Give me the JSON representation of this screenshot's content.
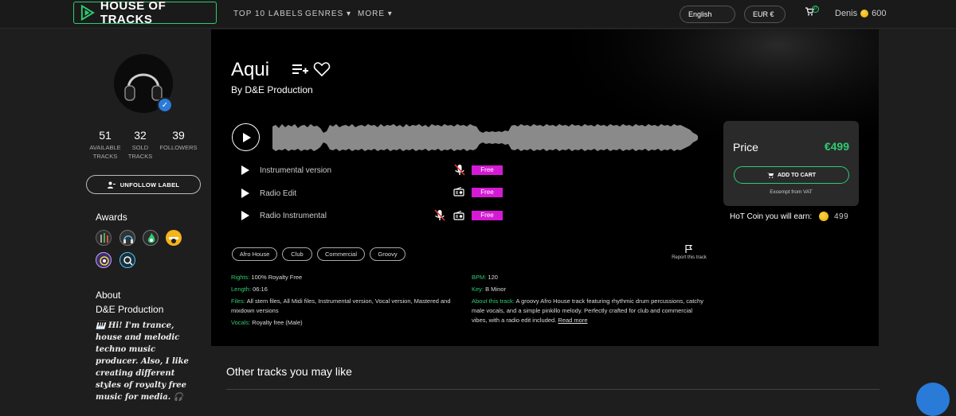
{
  "header": {
    "logo_text": "HOUSE OF TRACKS",
    "nav": [
      {
        "label": "TOP 10 LABELS"
      },
      {
        "label": "GENRES ▾"
      },
      {
        "label": "MORE ▾"
      }
    ],
    "language": "English",
    "currency": "EUR €",
    "cart_count": "0",
    "user_name": "Denis",
    "user_coins": "600"
  },
  "profile": {
    "stats": [
      {
        "value": "51",
        "label_line1": "AVAILABLE",
        "label_line2": "TRACKS"
      },
      {
        "value": "32",
        "label_line1": "SOLD",
        "label_line2": "TRACKS"
      },
      {
        "value": "39",
        "label_line1": "FOLLOWERS",
        "label_line2": ""
      }
    ],
    "unfollow_label": "UNFOLLOW LABEL",
    "awards_title": "Awards",
    "about_title": "About",
    "about_name": "D&E Production",
    "bio": "🎹 Hi! I'm trance, house and melodic techno music producer. Also, I like creating different styles of royalty free music for media. 🎧"
  },
  "track": {
    "title": "Aqui",
    "by": "By D&E Production",
    "versions": [
      {
        "label": "Instrumental version",
        "price": "Free"
      },
      {
        "label": "Radio Edit",
        "price": "Free"
      },
      {
        "label": "Radio Instrumental",
        "price": "Free"
      }
    ],
    "tags": [
      "Afro House",
      "Club",
      "Commercial",
      "Groovy"
    ],
    "report_label": "Report this track",
    "info_left": [
      {
        "key": "Rights:",
        "value": " 100% Royalty Free"
      },
      {
        "key": "Length:",
        "value": " 06:16"
      },
      {
        "key": "Files:",
        "value": " All stem files, All Midi files, Instrumental version, Vocal version, Mastered and mixdown versions"
      },
      {
        "key": "Vocals:",
        "value": " Royalty free (Male)"
      }
    ],
    "info_right": [
      {
        "key": "BPM:",
        "value": " 120"
      },
      {
        "key": "Key:",
        "value": " B Minor"
      },
      {
        "key": "About this track:",
        "value": " A groovy Afro House track featuring rhythmic drum percussions, catchy male vocals, and a simple pinkillo melody. Perfectly crafted for club and commercial vibes, with a radio edit included. "
      }
    ],
    "read_more": "Read more"
  },
  "purchase": {
    "price_label": "Price",
    "price_value": "€499",
    "add_to_cart": "ADD TO CART",
    "vat_note": "Excempt from VAT",
    "earn_label": "HoT Coin you will earn:",
    "earn_value": "499"
  },
  "related": {
    "title": "Other tracks you may like"
  },
  "colors": {
    "accent": "#2ecc71",
    "free_badge": "#d41ad4",
    "verified": "#2a7ad8"
  }
}
